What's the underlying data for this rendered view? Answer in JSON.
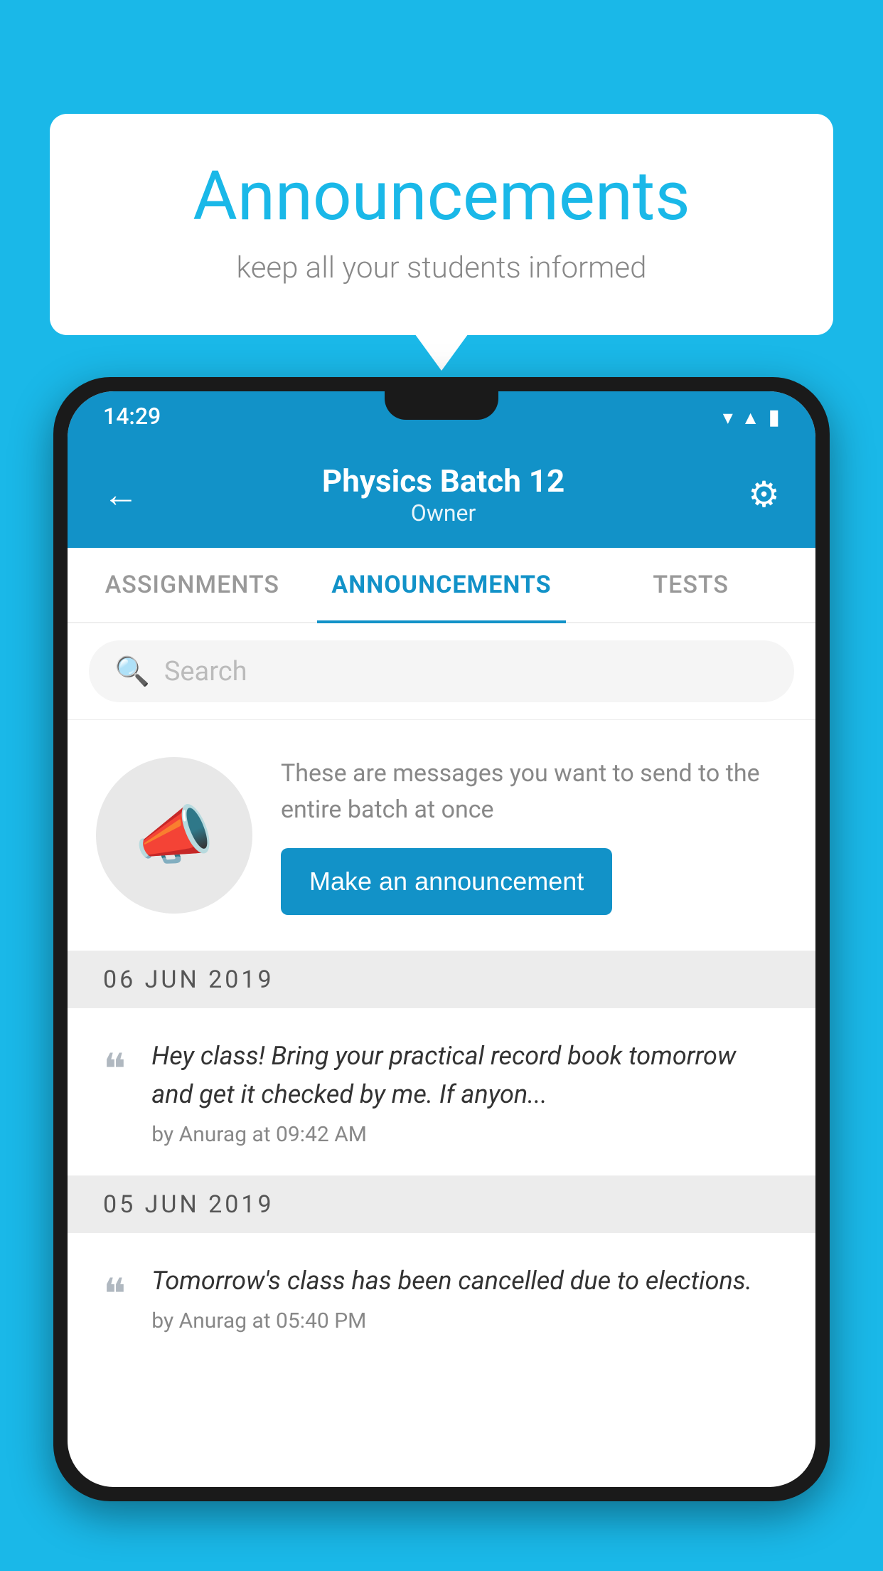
{
  "background_color": "#1ab8e8",
  "speech_bubble": {
    "title": "Announcements",
    "subtitle": "keep all your students informed"
  },
  "phone": {
    "status_bar": {
      "time": "14:29"
    },
    "header": {
      "title": "Physics Batch 12",
      "subtitle": "Owner",
      "back_label": "←",
      "settings_label": "⚙"
    },
    "tabs": [
      {
        "label": "ASSIGNMENTS",
        "active": false
      },
      {
        "label": "ANNOUNCEMENTS",
        "active": true
      },
      {
        "label": "TESTS",
        "active": false
      }
    ],
    "search": {
      "placeholder": "Search"
    },
    "announcement_prompt": {
      "description_text": "These are messages you want to send to the entire batch at once",
      "button_label": "Make an announcement"
    },
    "announcements": [
      {
        "date": "06  JUN  2019",
        "text": "Hey class! Bring your practical record book tomorrow and get it checked by me. If anyon...",
        "meta": "by Anurag at 09:42 AM"
      },
      {
        "date": "05  JUN  2019",
        "text": "Tomorrow's class has been cancelled due to elections.",
        "meta": "by Anurag at 05:40 PM"
      }
    ]
  }
}
